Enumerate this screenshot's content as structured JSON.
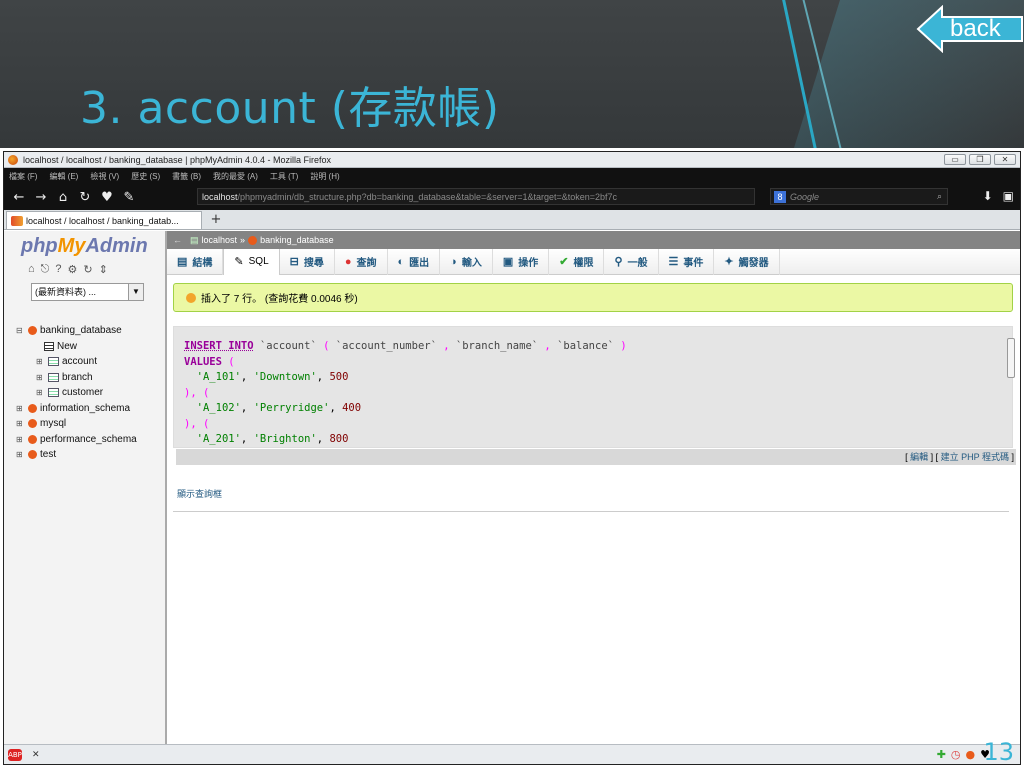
{
  "slide": {
    "title": "3. account (存款帳)",
    "back_label": "back",
    "page_number": "13"
  },
  "window": {
    "title": "localhost / localhost / banking_database | phpMyAdmin 4.0.4 - Mozilla Firefox",
    "controls": [
      "▭",
      "❐",
      "✕"
    ]
  },
  "menubar": [
    "檔案 (F)",
    "編輯 (E)",
    "檢視 (V)",
    "歷史 (S)",
    "書籤 (B)",
    "我的最愛 (A)",
    "工具 (T)",
    "說明 (H)"
  ],
  "navbar": {
    "url_host": "localhost",
    "url_rest": "/phpmyadmin/db_structure.php?db=banking_database&table=&server=1&target=&token=2bf7c",
    "search_placeholder": "Google"
  },
  "tabs": [
    {
      "label": "localhost / localhost / banking_datab..."
    }
  ],
  "pma": {
    "logo_php": "php",
    "logo_my": "My",
    "logo_admin": "Admin",
    "recent_select": "(最新資料表) ...",
    "tree": [
      {
        "label": "banking_database",
        "type": "db",
        "level": 0
      },
      {
        "label": "New",
        "type": "new",
        "level": 1
      },
      {
        "label": "account",
        "type": "table",
        "level": 1
      },
      {
        "label": "branch",
        "type": "table",
        "level": 1
      },
      {
        "label": "customer",
        "type": "table",
        "level": 1
      },
      {
        "label": "information_schema",
        "type": "db",
        "level": 0
      },
      {
        "label": "mysql",
        "type": "db",
        "level": 0
      },
      {
        "label": "performance_schema",
        "type": "db",
        "level": 0
      },
      {
        "label": "test",
        "type": "db",
        "level": 0
      }
    ],
    "breadcrumb_server": "localhost",
    "breadcrumb_sep": "»",
    "breadcrumb_db": "banking_database",
    "toptabs": [
      {
        "label": "結構",
        "icon": "table-icon"
      },
      {
        "label": "SQL",
        "icon": "wrench-icon",
        "active": true
      },
      {
        "label": "搜尋",
        "icon": "search-icon"
      },
      {
        "label": "查詢",
        "icon": "query-icon"
      },
      {
        "label": "匯出",
        "icon": "export-icon"
      },
      {
        "label": "輸入",
        "icon": "import-icon"
      },
      {
        "label": "操作",
        "icon": "operations-icon"
      },
      {
        "label": "權限",
        "icon": "check-icon"
      },
      {
        "label": "一般",
        "icon": "magnifier-icon"
      },
      {
        "label": "事件",
        "icon": "events-icon"
      },
      {
        "label": "觸發器",
        "icon": "triggers-icon"
      }
    ],
    "success_message": "插入了 7 行。 (查詢花費 0.0046 秒)",
    "sql": {
      "insert_kw": "INSERT INTO",
      "table": "`account`",
      "col1": "`account_number`",
      "col2": "`branch_name`",
      "col3": "`balance`",
      "values_kw": "VALUES",
      "rows": [
        {
          "a": "'A_101'",
          "b": "'Downtown'",
          "c": "500"
        },
        {
          "a": "'A_102'",
          "b": "'Perryridge'",
          "c": "400"
        },
        {
          "a": "'A_201'",
          "b": "'Brighton'",
          "c": "800"
        }
      ]
    },
    "edit_link": "編輯",
    "create_php_link": "建立 PHP 程式碼",
    "show_query_box": "顯示查詢框"
  }
}
